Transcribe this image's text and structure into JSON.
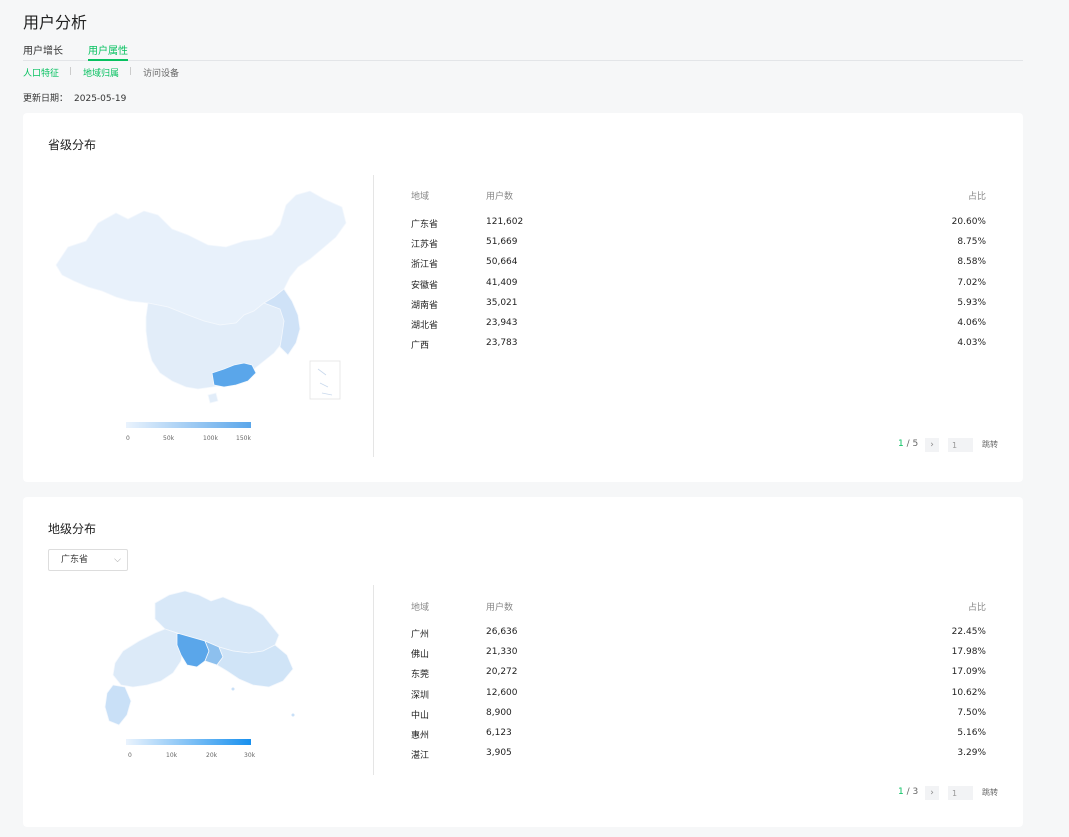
{
  "page": {
    "title": "用户分析"
  },
  "tabs": [
    {
      "label": "用户增长"
    },
    {
      "label": "用户属性"
    }
  ],
  "subtabs": [
    {
      "label": "人口特征"
    },
    {
      "label": "地域归属"
    },
    {
      "label": "访问设备"
    }
  ],
  "update": {
    "label": "更新日期：",
    "date": "2025-05-19"
  },
  "province": {
    "title": "省级分布",
    "legend": [
      "0",
      "50k",
      "100k",
      "150k"
    ],
    "headers": {
      "name": "地域",
      "users": "用户数",
      "ratio": "占比"
    },
    "rows": [
      {
        "name": "广东省",
        "users": "121,602",
        "ratio": "20.60%"
      },
      {
        "name": "江苏省",
        "users": "51,669",
        "ratio": "8.75%"
      },
      {
        "name": "浙江省",
        "users": "50,664",
        "ratio": "8.58%"
      },
      {
        "name": "安徽省",
        "users": "41,409",
        "ratio": "7.02%"
      },
      {
        "name": "湖南省",
        "users": "35,021",
        "ratio": "5.93%"
      },
      {
        "name": "湖北省",
        "users": "23,943",
        "ratio": "4.06%"
      },
      {
        "name": "广西",
        "users": "23,783",
        "ratio": "4.03%"
      }
    ],
    "pager": {
      "current": "1",
      "total": "/ 5",
      "input": "1",
      "jump": "跳转"
    }
  },
  "city": {
    "title": "地级分布",
    "select_value": "广东省",
    "legend": [
      "0",
      "10k",
      "20k",
      "30k"
    ],
    "headers": {
      "name": "地域",
      "users": "用户数",
      "ratio": "占比"
    },
    "rows": [
      {
        "name": "广州",
        "users": "26,636",
        "ratio": "22.45%"
      },
      {
        "name": "佛山",
        "users": "21,330",
        "ratio": "17.98%"
      },
      {
        "name": "东莞",
        "users": "20,272",
        "ratio": "17.09%"
      },
      {
        "name": "深圳",
        "users": "12,600",
        "ratio": "10.62%"
      },
      {
        "name": "中山",
        "users": "8,900",
        "ratio": "7.50%"
      },
      {
        "name": "惠州",
        "users": "6,123",
        "ratio": "5.16%"
      },
      {
        "name": "湛江",
        "users": "3,905",
        "ratio": "3.29%"
      }
    ],
    "pager": {
      "current": "1",
      "total": "/ 3",
      "input": "1",
      "jump": "跳转"
    }
  },
  "colors": {
    "accent": "#07c160",
    "map_light": "#e8f1fb",
    "map_mid": "#c9e0f7",
    "map_dark": "#5aa6ea",
    "legend_city_end": "#1890ee"
  }
}
